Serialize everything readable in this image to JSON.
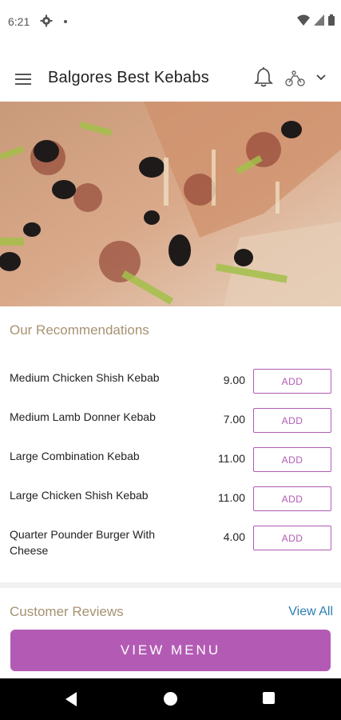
{
  "status_bar": {
    "time": "6:21"
  },
  "app_bar": {
    "title": "Balgores Best Kebabs"
  },
  "recommendations": {
    "title": "Our Recommendations",
    "items": [
      {
        "name": "Medium Chicken Shish Kebab",
        "price": "9.00",
        "button": "ADD"
      },
      {
        "name": "Medium Lamb Donner Kebab",
        "price": "7.00",
        "button": "ADD"
      },
      {
        "name": "Large Combination Kebab",
        "price": "11.00",
        "button": "ADD"
      },
      {
        "name": "Large Chicken Shish Kebab",
        "price": "11.00",
        "button": "ADD"
      },
      {
        "name": "Quarter Pounder Burger With Cheese",
        "price": "4.00",
        "button": "ADD"
      }
    ]
  },
  "reviews": {
    "title": "Customer Reviews",
    "view_all": "View All"
  },
  "cta": {
    "label": "VIEW MENU"
  },
  "colors": {
    "accent": "#b35bb4",
    "heading": "#a69272",
    "link": "#2b7fb3"
  }
}
